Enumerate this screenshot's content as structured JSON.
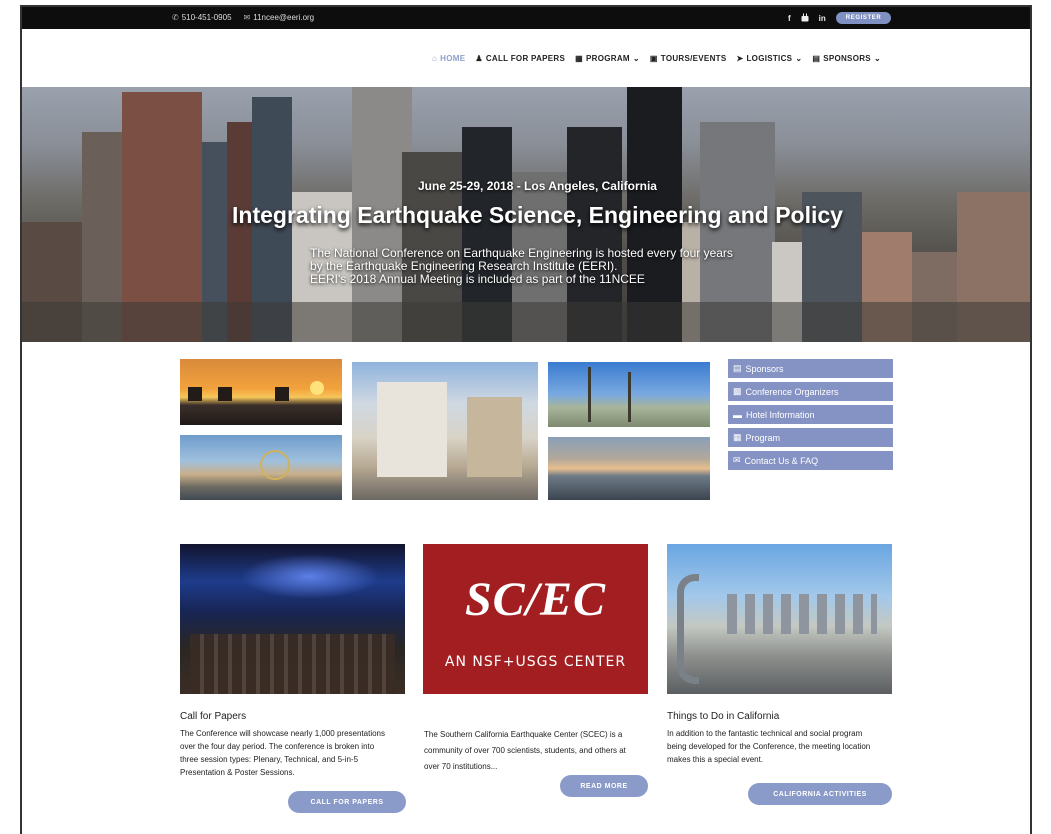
{
  "topbar": {
    "phone": "510-451-0905",
    "email": "11ncee@eeri.org",
    "social": [
      "f",
      "in"
    ],
    "register_label": "REGISTER"
  },
  "nav": {
    "items": [
      {
        "label": "HOME",
        "icon": "home-icon",
        "active": true
      },
      {
        "label": "CALL FOR PAPERS",
        "icon": "users-icon"
      },
      {
        "label": "PROGRAM",
        "icon": "calendar-icon",
        "dropdown": true
      },
      {
        "label": "TOURS/EVENTS",
        "icon": "image-icon"
      },
      {
        "label": "LOGISTICS",
        "icon": "send-icon",
        "dropdown": true
      },
      {
        "label": "SPONSORS",
        "icon": "document-icon",
        "dropdown": true
      }
    ]
  },
  "hero": {
    "date": "June 25-29, 2018 - Los Angeles, California",
    "title": "Integrating Earthquake Science, Engineering and Policy",
    "desc_line1": "The National Conference on Earthquake Engineering is hosted every four years",
    "desc_line2": "by the Earthquake Engineering Research Institute (EERI).",
    "desc_line3": "EERI's 2018 Annual Meeting is included as part of the 11NCEE"
  },
  "side_menu": {
    "items": [
      {
        "label": "Sponsors",
        "icon": "document-icon"
      },
      {
        "label": "Conference Organizers",
        "icon": "organizers-icon"
      },
      {
        "label": "Hotel Information",
        "icon": "bed-icon"
      },
      {
        "label": "Program",
        "icon": "calendar-icon"
      },
      {
        "label": "Contact Us & FAQ",
        "icon": "envelope-icon"
      }
    ]
  },
  "features": {
    "papers": {
      "title": "Call for Papers",
      "text1": "The Conference will showcase nearly 1,000 presentations",
      "text2": "over the four day period. The conference is broken into",
      "text3": "three session types: Plenary, Technical, and 5-in-5",
      "text4": "Presentation & Poster Sessions.",
      "button": "CALL FOR PAPERS"
    },
    "scec": {
      "logo": "SC/EC",
      "subtitle": "AN NSF+USGS CENTER",
      "text1": "The Southern California Earthquake Center (SCEC) is a",
      "text2": "community of over 700 scientists, students, and others at",
      "text3": "over 70 institutions...",
      "button": "READ MORE"
    },
    "california": {
      "title": "Things to Do in California",
      "text1": "In addition to the fantastic technical and social program",
      "text2": "being developed for the Conference, the meeting location",
      "text3": "makes this a special event.",
      "button": "CALIFORNIA ACTIVITIES"
    }
  },
  "colors": {
    "accent": "#8593c4",
    "topbar": "#0d0d0d",
    "scec_red": "#a31e20"
  }
}
